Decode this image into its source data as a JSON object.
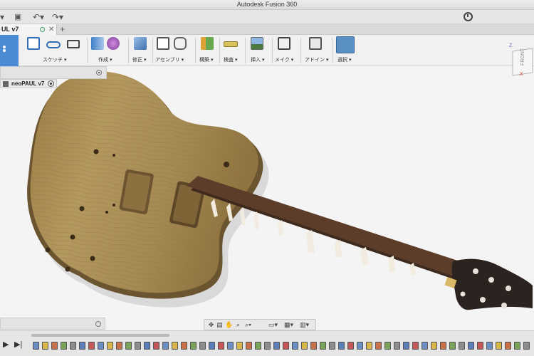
{
  "window": {
    "title": "Autodesk Fusion 360"
  },
  "document_tab": {
    "label": "UL v7",
    "add_label": "+"
  },
  "toolbar": {
    "groups": [
      {
        "label": "スケッチ ▾",
        "icon": "sketch-icon"
      },
      {
        "label": "作成 ▾",
        "icon": "create-icon"
      },
      {
        "label": "修正 ▾",
        "icon": "modify-icon"
      },
      {
        "label": "アセンブリ ▾",
        "icon": "assemble-icon"
      },
      {
        "label": "構築 ▾",
        "icon": "construct-icon"
      },
      {
        "label": "検査 ▾",
        "icon": "inspect-icon"
      },
      {
        "label": "挿入 ▾",
        "icon": "insert-icon"
      },
      {
        "label": "メイク ▾",
        "icon": "make-icon"
      },
      {
        "label": "アドイン ▾",
        "icon": "addin-icon"
      },
      {
        "label": "選択 ▾",
        "icon": "select-icon"
      }
    ]
  },
  "browser": {
    "root_label": "neoPAUL v7"
  },
  "viewcube": {
    "label": "FRONT",
    "axis_z": "Z",
    "axis_x": "X"
  },
  "colors": {
    "accent": "#4a8bd4",
    "body_wood": "#a88a55",
    "neck": "#5a3b2a",
    "headstock": "#2a2320"
  }
}
